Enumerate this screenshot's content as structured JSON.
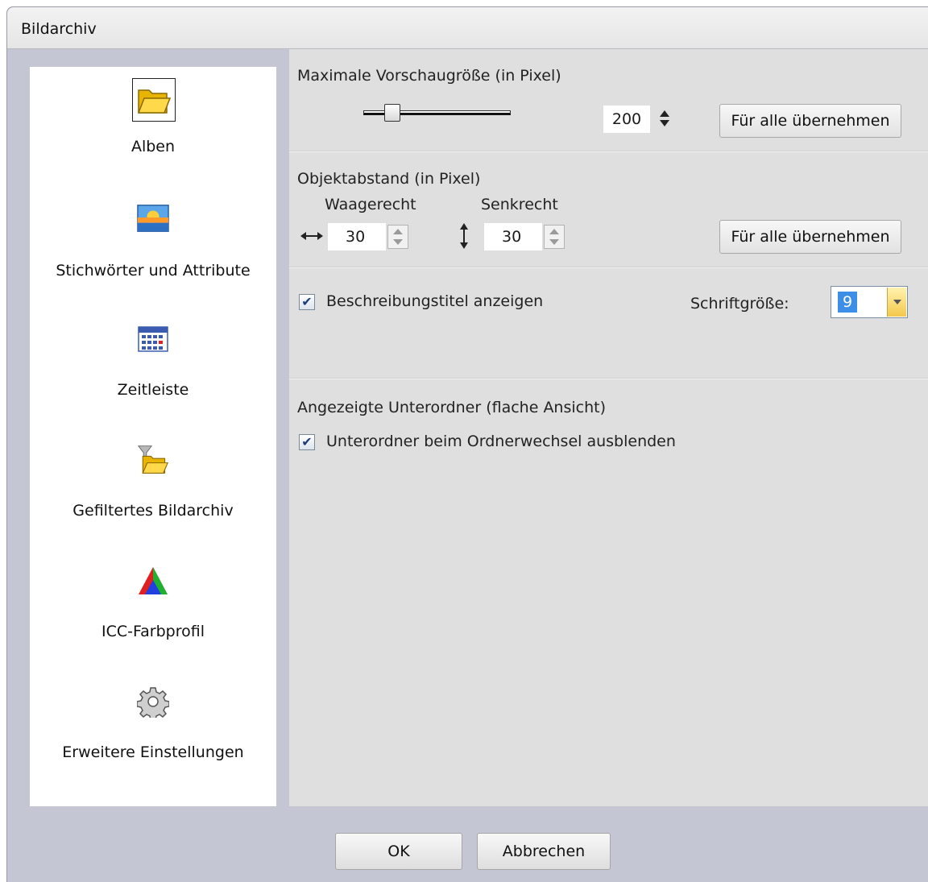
{
  "window": {
    "title": "Bildarchiv"
  },
  "sidebar": {
    "items": [
      {
        "label": "Alben",
        "icon": "folder-open-icon",
        "selected": true
      },
      {
        "label": "Stichwörter und Attribute",
        "icon": "landscape-image-icon",
        "selected": false
      },
      {
        "label": "Zeitleiste",
        "icon": "calendar-icon",
        "selected": false
      },
      {
        "label": "Gefiltertes Bildarchiv",
        "icon": "filter-folder-icon",
        "selected": false
      },
      {
        "label": "ICC-Farbprofil",
        "icon": "color-triangle-icon",
        "selected": false
      },
      {
        "label": "Erweitere Einstellungen",
        "icon": "gear-icon",
        "selected": false
      }
    ]
  },
  "preview": {
    "heading": "Maximale Vorschaugröße (in Pixel)",
    "value": "200",
    "apply_label": "Für alle übernehmen"
  },
  "spacing": {
    "heading": "Objektabstand (in Pixel)",
    "horizontal_label": "Waagerecht",
    "horizontal_value": "30",
    "vertical_label": "Senkrecht",
    "vertical_value": "30",
    "apply_label": "Für alle übernehmen"
  },
  "captions": {
    "show_title_label": "Beschreibungstitel anzeigen",
    "show_title_checked": true,
    "font_size_label": "Schriftgröße:",
    "font_size_value": "9"
  },
  "subfolders": {
    "heading": "Angezeigte Unterordner (flache Ansicht)",
    "hide_label": "Unterordner beim Ordnerwechsel ausblenden",
    "hide_checked": true
  },
  "footer": {
    "ok_label": "OK",
    "cancel_label": "Abbrechen"
  },
  "colors": {
    "window_bg": "#c4c7d3",
    "panel_bg": "#dfdfdf",
    "selection_blue": "#3d8ee6"
  }
}
